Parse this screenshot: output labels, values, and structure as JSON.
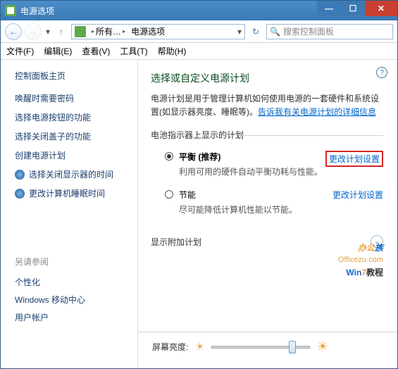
{
  "window": {
    "title": "电源选项"
  },
  "nav": {
    "seg1": "所有…",
    "seg2": "电源选项",
    "search_placeholder": "搜索控制面板"
  },
  "menu": {
    "file": "文件(F)",
    "edit": "编辑(E)",
    "view": "查看(V)",
    "tools": "工具(T)",
    "help": "帮助(H)"
  },
  "sidebar": {
    "header": "控制面板主页",
    "items": [
      "唤醒时需要密码",
      "选择电源按钮的功能",
      "选择关闭盖子的功能",
      "创建电源计划",
      "选择关闭显示器的时间",
      "更改计算机睡眠时间"
    ],
    "also_header": "另请参阅",
    "also": [
      "个性化",
      "Windows 移动中心",
      "用户帐户"
    ]
  },
  "main": {
    "heading": "选择或自定义电源计划",
    "desc_pre": "电源计划是用于管理计算机如何使用电源的一套硬件和系统设置(如显示器亮度、睡眠等)。",
    "desc_link": "告诉我有关电源计划的详细信息",
    "group_label": "电池指示器上显示的计划",
    "plans": [
      {
        "name": "平衡 (推荐)",
        "desc": "利用可用的硬件自动平衡功耗与性能。",
        "action": "更改计划设置",
        "checked": true,
        "highlight": true
      },
      {
        "name": "节能",
        "desc": "尽可能降低计算机性能以节能。",
        "action": "更改计划设置",
        "checked": false,
        "highlight": false
      }
    ],
    "show_more": "显示附加计划",
    "brightness_label": "屏幕亮度:",
    "help_glyph": "?"
  },
  "watermark": {
    "line1a": "办公",
    "line1b": "族",
    "line2": "Officezu.com",
    "line3w": "Win",
    "line3n": "7",
    "line3t": "教程"
  },
  "chart_data": {
    "type": "slider",
    "label": "屏幕亮度",
    "range": [
      0,
      100
    ],
    "value": 85
  }
}
